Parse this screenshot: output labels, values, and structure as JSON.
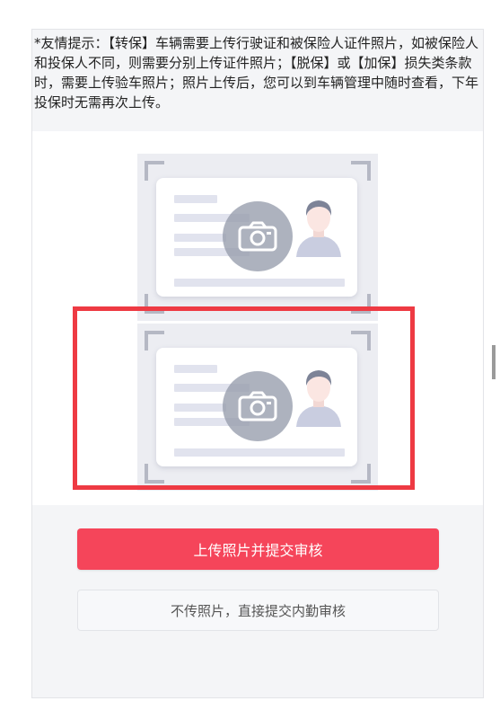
{
  "notice": {
    "text": "*友情提示：【转保】车辆需要上传行驶证和被保险人证件照片，如被保险人和投保人不同，则需要分别上传证件照片；【脱保】或【加保】损失类条款时，需要上传验车照片；照片上传后，您可以到车辆管理中随时查看，下年投保时无需再次上传。"
  },
  "upload": {
    "slots": [
      {
        "name": "id-card-front",
        "icon": "camera-icon"
      },
      {
        "name": "id-card-back",
        "icon": "camera-icon"
      }
    ]
  },
  "actions": {
    "primary_label": "上传照片并提交审核",
    "secondary_label": "不传照片，直接提交内勤审核"
  },
  "colors": {
    "primary": "#f5455a",
    "highlight": "#ee3a43",
    "panel_bg": "#f4f5f7"
  }
}
